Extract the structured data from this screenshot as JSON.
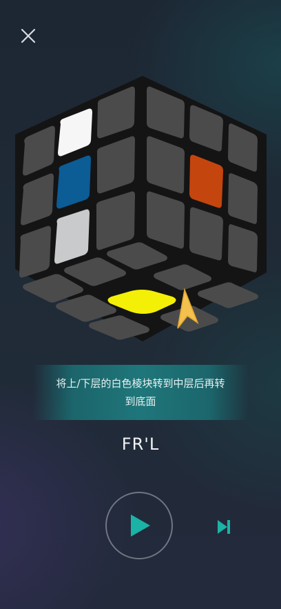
{
  "screen": {
    "close_icon": "close-icon",
    "instruction": "将上/下层的白色棱块转到中层后再转到底面",
    "move_notation": "FR'L",
    "play_icon": "play-icon",
    "skip_icon": "skip-next-icon"
  },
  "cube": {
    "highlight_colors": {
      "white": "#f6f6f6",
      "blue": "#0c5c95",
      "silver": "#c9cacb",
      "orange": "#c5450f",
      "yellow": "#f4ef06",
      "arrow": "#f2c14e"
    },
    "body_color": "#4b4b4b"
  },
  "theme": {
    "accent": "#1ab3a5",
    "banner": "#1e8486"
  }
}
